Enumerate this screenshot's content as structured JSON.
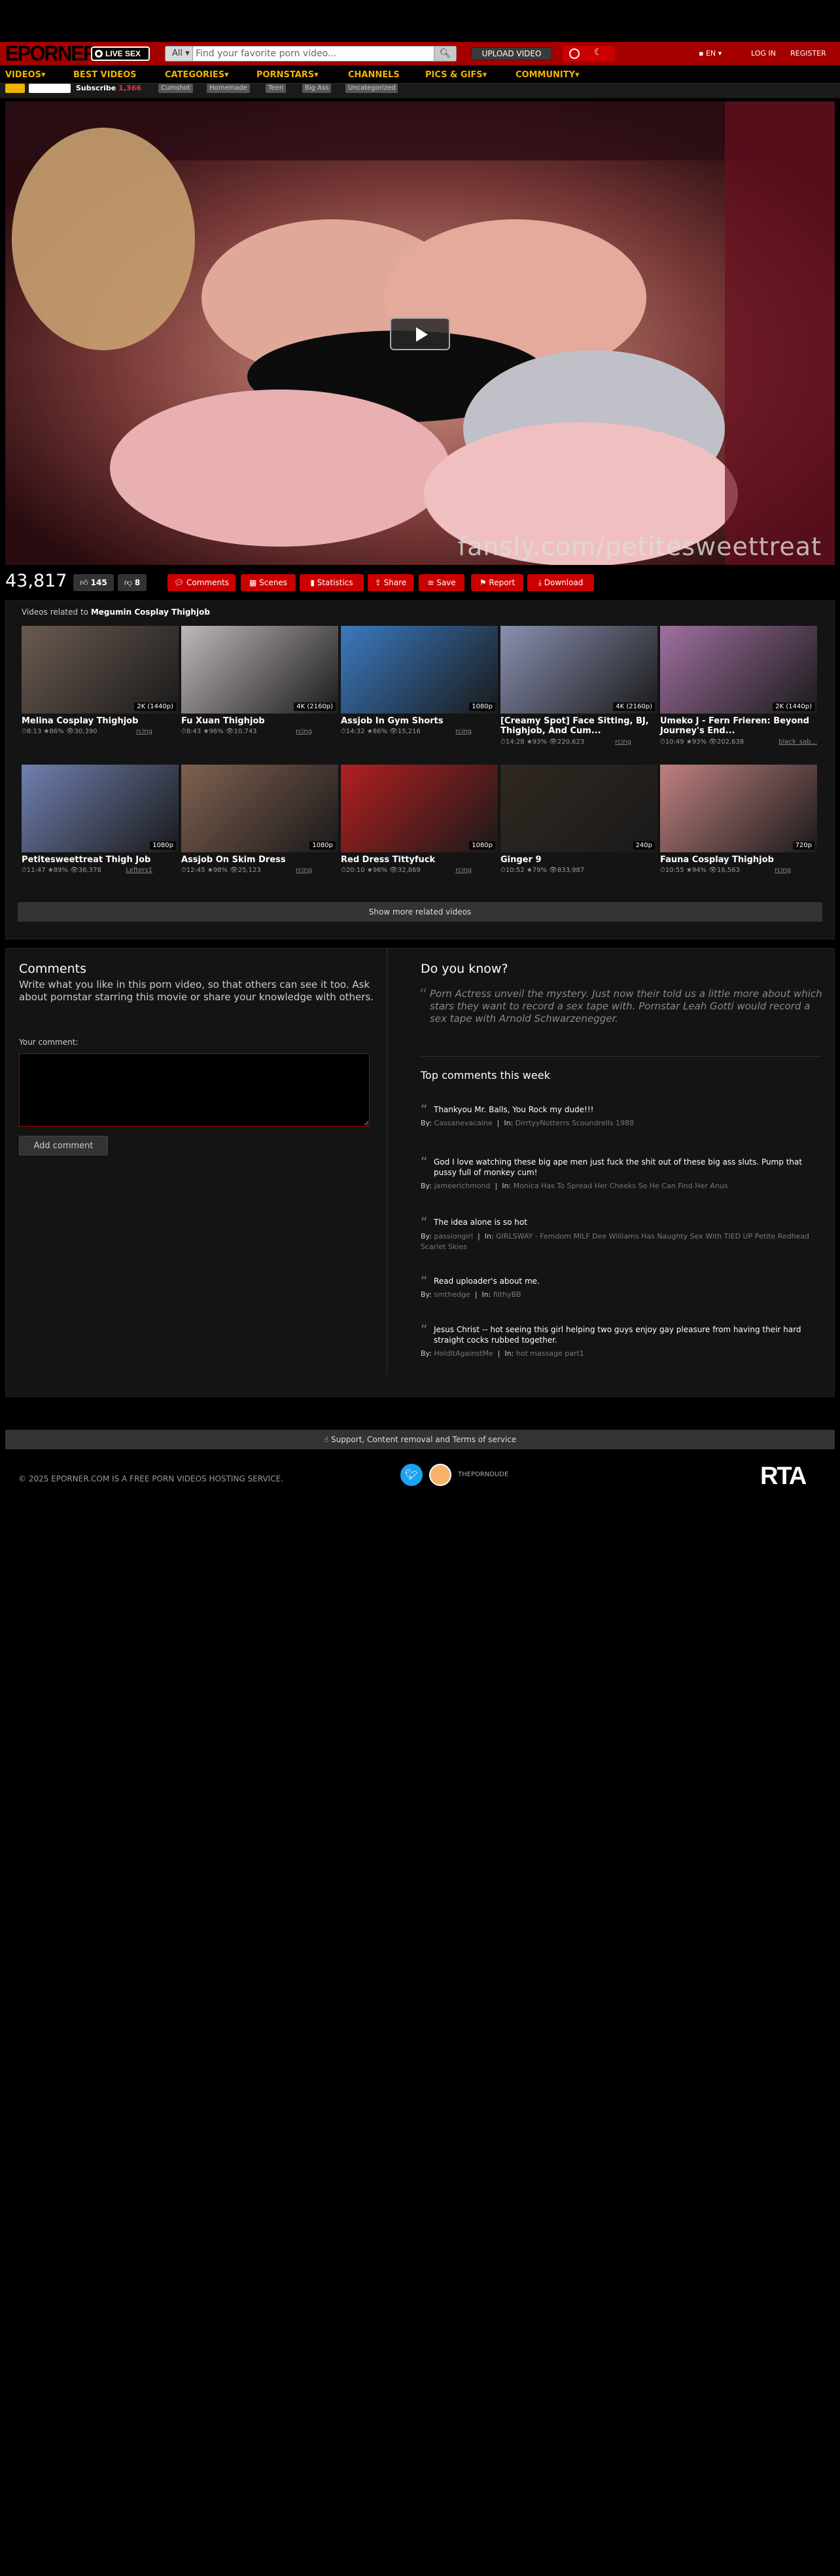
{
  "header": {
    "logo": "EPORNER",
    "live_sex": "LIVE SEX",
    "search_category": "All",
    "search_placeholder": "Find your favorite porn video...",
    "upload_button": "UPLOAD VIDEO",
    "language": "EN",
    "login": "LOG IN",
    "register": "REGISTER"
  },
  "nav": {
    "items": [
      "VIDEOS",
      "BEST VIDEOS",
      "CATEGORIES",
      "PORNSTARS",
      "CHANNELS",
      "PICS & GIFS",
      "COMMUNITY"
    ]
  },
  "substrip": {
    "subscribe_label": "Subscribe",
    "subscribe_count": "1,366",
    "tags": [
      "Cumshot",
      "Homemade",
      "Teen",
      "Big Ass",
      "Uncategorized"
    ]
  },
  "video": {
    "watermark": "fansly.com/petitesweettreat"
  },
  "actions": {
    "views": "43,817",
    "likes": "145",
    "dislikes": "8",
    "buttons": [
      "Comments",
      "Scenes",
      "Statistics",
      "Share",
      "Save",
      "Report",
      "Download"
    ]
  },
  "related": {
    "prefix": "Videos related to",
    "subject": "Megumin Cosplay Thighjob",
    "cards": [
      {
        "title": "Melina Cosplay Thighjob",
        "quality": "2K (1440p)",
        "duration": "8:13",
        "rating": "86%",
        "views": "30,390",
        "uploader": "rcing",
        "color": "#6a5a50"
      },
      {
        "title": "Fu Xuan Thighjob",
        "quality": "4K (2160p)",
        "duration": "8:43",
        "rating": "96%",
        "views": "10,743",
        "uploader": "rcing",
        "color": "#c0b8b8"
      },
      {
        "title": "Assjob In Gym Shorts",
        "quality": "1080p",
        "duration": "14:32",
        "rating": "86%",
        "views": "15,216",
        "uploader": "rcing",
        "color": "#3a7ac0"
      },
      {
        "title": "[Creamy Spot] Face Sitting, BJ, Thighjob, And Cum...",
        "quality": "4K (2160p)",
        "duration": "14:28",
        "rating": "93%",
        "views": "220,623",
        "uploader": "rcing",
        "color": "#8a90b0"
      },
      {
        "title": "Umeko J - Fern Frieren: Beyond Journey's End...",
        "quality": "2K (1440p)",
        "duration": "10:49",
        "rating": "93%",
        "views": "202,638",
        "uploader": "black_sab...",
        "color": "#a070a0"
      },
      {
        "title": "Petitesweettreat Thigh Job",
        "quality": "1080p",
        "duration": "11:47",
        "rating": "89%",
        "views": "36,378",
        "uploader": "Lefters1",
        "color": "#7080b0"
      },
      {
        "title": "Assjob On Skim Dress",
        "quality": "1080p",
        "duration": "12:45",
        "rating": "98%",
        "views": "25,123",
        "uploader": "rcing",
        "color": "#806050"
      },
      {
        "title": "Red Dress Tittyfuck",
        "quality": "1080p",
        "duration": "20:10",
        "rating": "96%",
        "views": "32,869",
        "uploader": "rcing",
        "color": "#b02020"
      },
      {
        "title": "Ginger 9",
        "quality": "240p",
        "duration": "10:52",
        "rating": "79%",
        "views": "833,987",
        "uploader": "",
        "color": "#302820"
      },
      {
        "title": "Fauna Cosplay Thighjob",
        "quality": "720p",
        "duration": "10:55",
        "rating": "94%",
        "views": "16,563",
        "uploader": "rcing",
        "color": "#c08080"
      }
    ],
    "show_more": "Show more related videos"
  },
  "comments": {
    "title": "Comments",
    "description": "Write what you like in this porn video, so that others can see it too. Ask about pornstar starring this movie or share your knowledge with others.",
    "your_comment_label": "Your comment:",
    "add_button": "Add comment"
  },
  "did_you_know": {
    "title": "Do you know?",
    "text": "Porn Actress unveil the mystery. Just now their told us a little more about which stars they want to record a sex tape with. Pornstar Leah Gotti would record a sex tape with Arnold Schwarzenegger."
  },
  "top_comments": {
    "title": "Top comments this week",
    "by_label": "By:",
    "in_label": "In:",
    "items": [
      {
        "text": "Thankyou Mr. Balls, You Rock my dude!!!",
        "user": "Cassanevacaine",
        "video": "DirrtyyNotterrs Scoundrells 1988"
      },
      {
        "text": "God I love watching these big ape men just fuck the shit out of these big ass sluts. Pump that pussy full of monkey cum!",
        "user": "jameerichmond",
        "video": "Monica Has To Spread Her Cheeks So He Can Find Her Anus"
      },
      {
        "text": "The idea alone is so hot",
        "user": "passiongirl",
        "video": "GIRLSWAY - Femdom MILF Dee Williams Has Naughty Sex With TIED UP Petite Redhead Scarlet Skies"
      },
      {
        "text": "Read uploader's about me.",
        "user": "smthedge",
        "video": "filthyBB"
      },
      {
        "text": "Jesus Christ -- hot seeing this girl helping two guys enjoy gay pleasure from having their hard straight cocks rubbed together.",
        "user": "HoldItAgainstMe",
        "video": "hot massage part1"
      }
    ]
  },
  "footer": {
    "support": "Support, Content removal and Terms of service",
    "copyright": "© 2025 EPORNER.COM IS A FREE PORN VIDEOS HOSTING SERVICE.",
    "porndude_label": "THEPORNDUDE",
    "rta": "RTA"
  }
}
